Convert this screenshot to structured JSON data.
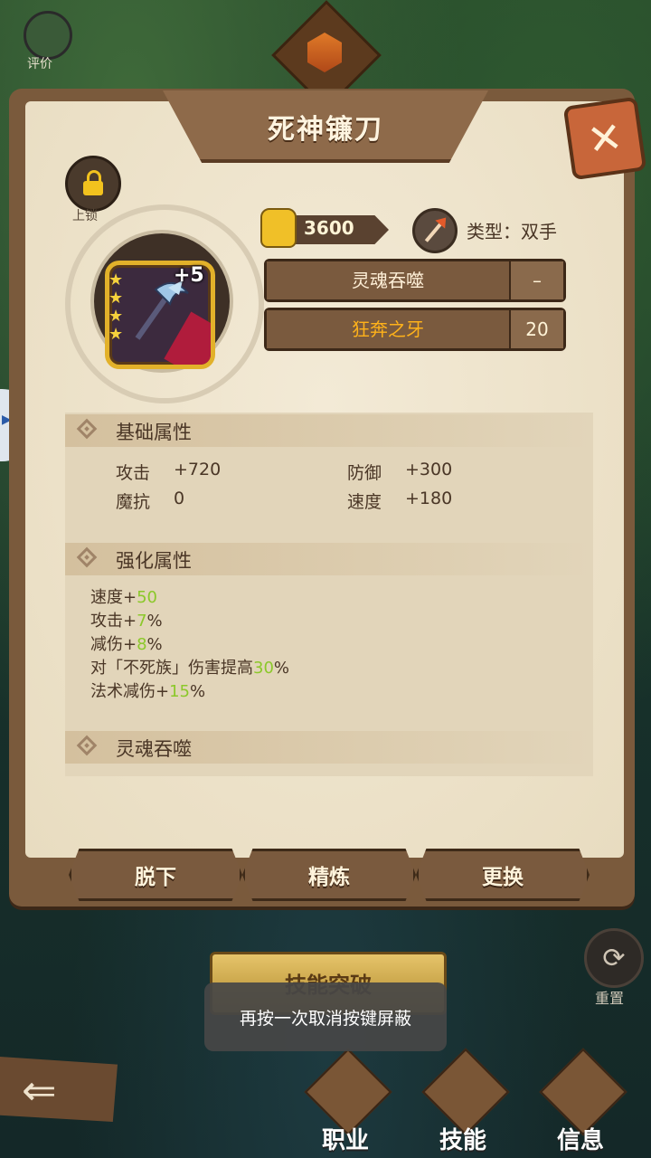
{
  "top": {
    "rate_label": "评价"
  },
  "item": {
    "name": "死神镰刀",
    "level": "+5",
    "stars": 4,
    "price": "3600",
    "type": "类型：双手"
  },
  "lock": {
    "label": "上锁"
  },
  "skills": [
    {
      "name": "灵魂吞噬",
      "value": "–",
      "color": "#fff0d8"
    },
    {
      "name": "狂奔之牙",
      "value": "20",
      "color": "#ffb21a"
    }
  ],
  "basic": {
    "title": "基础属性",
    "stats": [
      {
        "name": "攻击",
        "value": "+720"
      },
      {
        "name": "防御",
        "value": "+300"
      },
      {
        "name": "魔抗",
        "value": "0"
      },
      {
        "name": "速度",
        "value": "+180"
      }
    ]
  },
  "enhance": {
    "title": "强化属性",
    "lines": [
      {
        "prefix": "速度+",
        "value": "50",
        "suffix": ""
      },
      {
        "prefix": "攻击+",
        "value": "7",
        "suffix": "%"
      },
      {
        "prefix": "减伤+",
        "value": "8",
        "suffix": "%"
      },
      {
        "prefix": "对「不死族」伤害提高",
        "value": "30",
        "suffix": "%"
      },
      {
        "prefix": "法术减伤+",
        "value": "15",
        "suffix": "%"
      }
    ]
  },
  "soul": {
    "title": "灵魂吞噬"
  },
  "buttons": {
    "unequip": "脱下",
    "refine": "精炼",
    "replace": "更换"
  },
  "reset_label": "重置",
  "breakthrough_label": "技能突破",
  "toast": "再按一次取消按键屏蔽",
  "nav": [
    {
      "label": "职业",
      "icon": "pawn-icon"
    },
    {
      "label": "技能",
      "icon": "skill-icon"
    },
    {
      "label": "信息",
      "icon": "info-icon"
    }
  ],
  "colors": {
    "accent_green": "#8bc82a",
    "gold": "#e2b12a",
    "panel": "#efe4cc"
  }
}
